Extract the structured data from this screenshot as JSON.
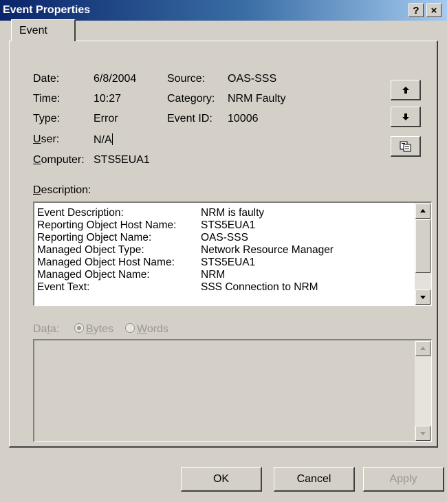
{
  "window": {
    "title": "Event Properties",
    "help_label": "?",
    "close_label": "×"
  },
  "tab": {
    "label": "Event"
  },
  "fields": {
    "date_label": "Date:",
    "date_value": "6/8/2004",
    "source_label": "Source:",
    "source_value": "OAS-SSS",
    "time_label": "Time:",
    "time_value": "10:27",
    "category_label": "Category:",
    "category_value": "NRM Faulty",
    "type_label": "Type:",
    "type_value": "Error",
    "eventid_label": "Event ID:",
    "eventid_value": "10006",
    "user_label_first": "U",
    "user_label_rest": "ser:",
    "user_value": "N/A",
    "computer_label_first": "C",
    "computer_label_rest": "omputer:",
    "computer_value": "STS5EUA1"
  },
  "description": {
    "label_first": "D",
    "label_rest": "escription:",
    "rows": [
      {
        "key": "Event Description:",
        "value": "NRM is faulty"
      },
      {
        "key": "Reporting Object Host Name:",
        "value": "STS5EUA1"
      },
      {
        "key": "Reporting Object Name:",
        "value": "OAS-SSS"
      },
      {
        "key": "Managed Object Type:",
        "value": "Network Resource Manager"
      },
      {
        "key": "Managed Object Host Name:",
        "value": "STS5EUA1"
      },
      {
        "key": "Managed Object Name:",
        "value": "NRM"
      },
      {
        "key": "Event Text:",
        "value": "SSS Connection to NRM"
      }
    ]
  },
  "data": {
    "label_pre": "Da",
    "label_u": "t",
    "label_post": "a:",
    "bytes_first": "B",
    "bytes_rest": "ytes",
    "words_first": "W",
    "words_rest": "ords",
    "selected": "Bytes"
  },
  "buttons": {
    "ok": "OK",
    "cancel": "Cancel",
    "apply": "Apply"
  },
  "icons": {
    "up": "arrow-up-icon",
    "down": "arrow-down-icon",
    "copy": "copy-icon"
  }
}
